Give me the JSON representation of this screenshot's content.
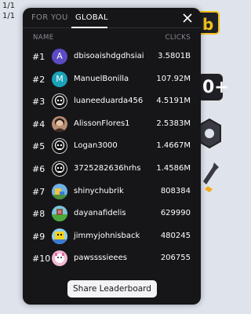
{
  "counters": [
    "1/1",
    "1/1"
  ],
  "hud": {
    "yellow_tile_glyph": "b",
    "plus_tile_glyph": "0+"
  },
  "tabs": [
    {
      "label": "FOR YOU",
      "active": false
    },
    {
      "label": "GLOBAL",
      "active": true
    }
  ],
  "columns": {
    "name": "NAME",
    "clicks": "CLICKS"
  },
  "rows": [
    {
      "rank": "#1",
      "name": "dbisoaishdgdhsiai",
      "clicks": "3.5801B",
      "avatar": {
        "type": "letter",
        "letter": "A",
        "color": "#5b4bc4"
      }
    },
    {
      "rank": "#2",
      "name": "ManuelBonilla",
      "clicks": "107.92M",
      "avatar": {
        "type": "letter",
        "letter": "M",
        "color": "#1aa3b8"
      }
    },
    {
      "rank": "#3",
      "name": "luaneeduarda456",
      "clicks": "4.5191M",
      "avatar": {
        "type": "skull"
      }
    },
    {
      "rank": "#4",
      "name": "AlissonFlores1",
      "clicks": "2.5383M",
      "avatar": {
        "type": "photo"
      }
    },
    {
      "rank": "#5",
      "name": "Logan3000",
      "clicks": "1.4667M",
      "avatar": {
        "type": "skull"
      }
    },
    {
      "rank": "#6",
      "name": "3725282636hrhs",
      "clicks": "1.4586M",
      "avatar": {
        "type": "skull"
      }
    },
    {
      "rank": "#7",
      "name": "shinychubrik",
      "clicks": "808384",
      "avatar": {
        "type": "pixel-blue"
      }
    },
    {
      "rank": "#8",
      "name": "dayanafidelis",
      "clicks": "629990",
      "avatar": {
        "type": "pixel-green"
      }
    },
    {
      "rank": "#9",
      "name": "jimmyjohnisback",
      "clicks": "480245",
      "avatar": {
        "type": "pixel-yellow"
      }
    },
    {
      "rank": "#10",
      "name": "pawssssieees",
      "clicks": "206755",
      "avatar": {
        "type": "pixel-pink"
      }
    }
  ],
  "share_label": "Share Leaderboard",
  "colors": {
    "modal_bg": "#161619",
    "muted_text": "#8a8a92",
    "accent_white": "#ffffff"
  },
  "icons": [
    "close-icon",
    "gear-icon",
    "wrench-icon"
  ]
}
